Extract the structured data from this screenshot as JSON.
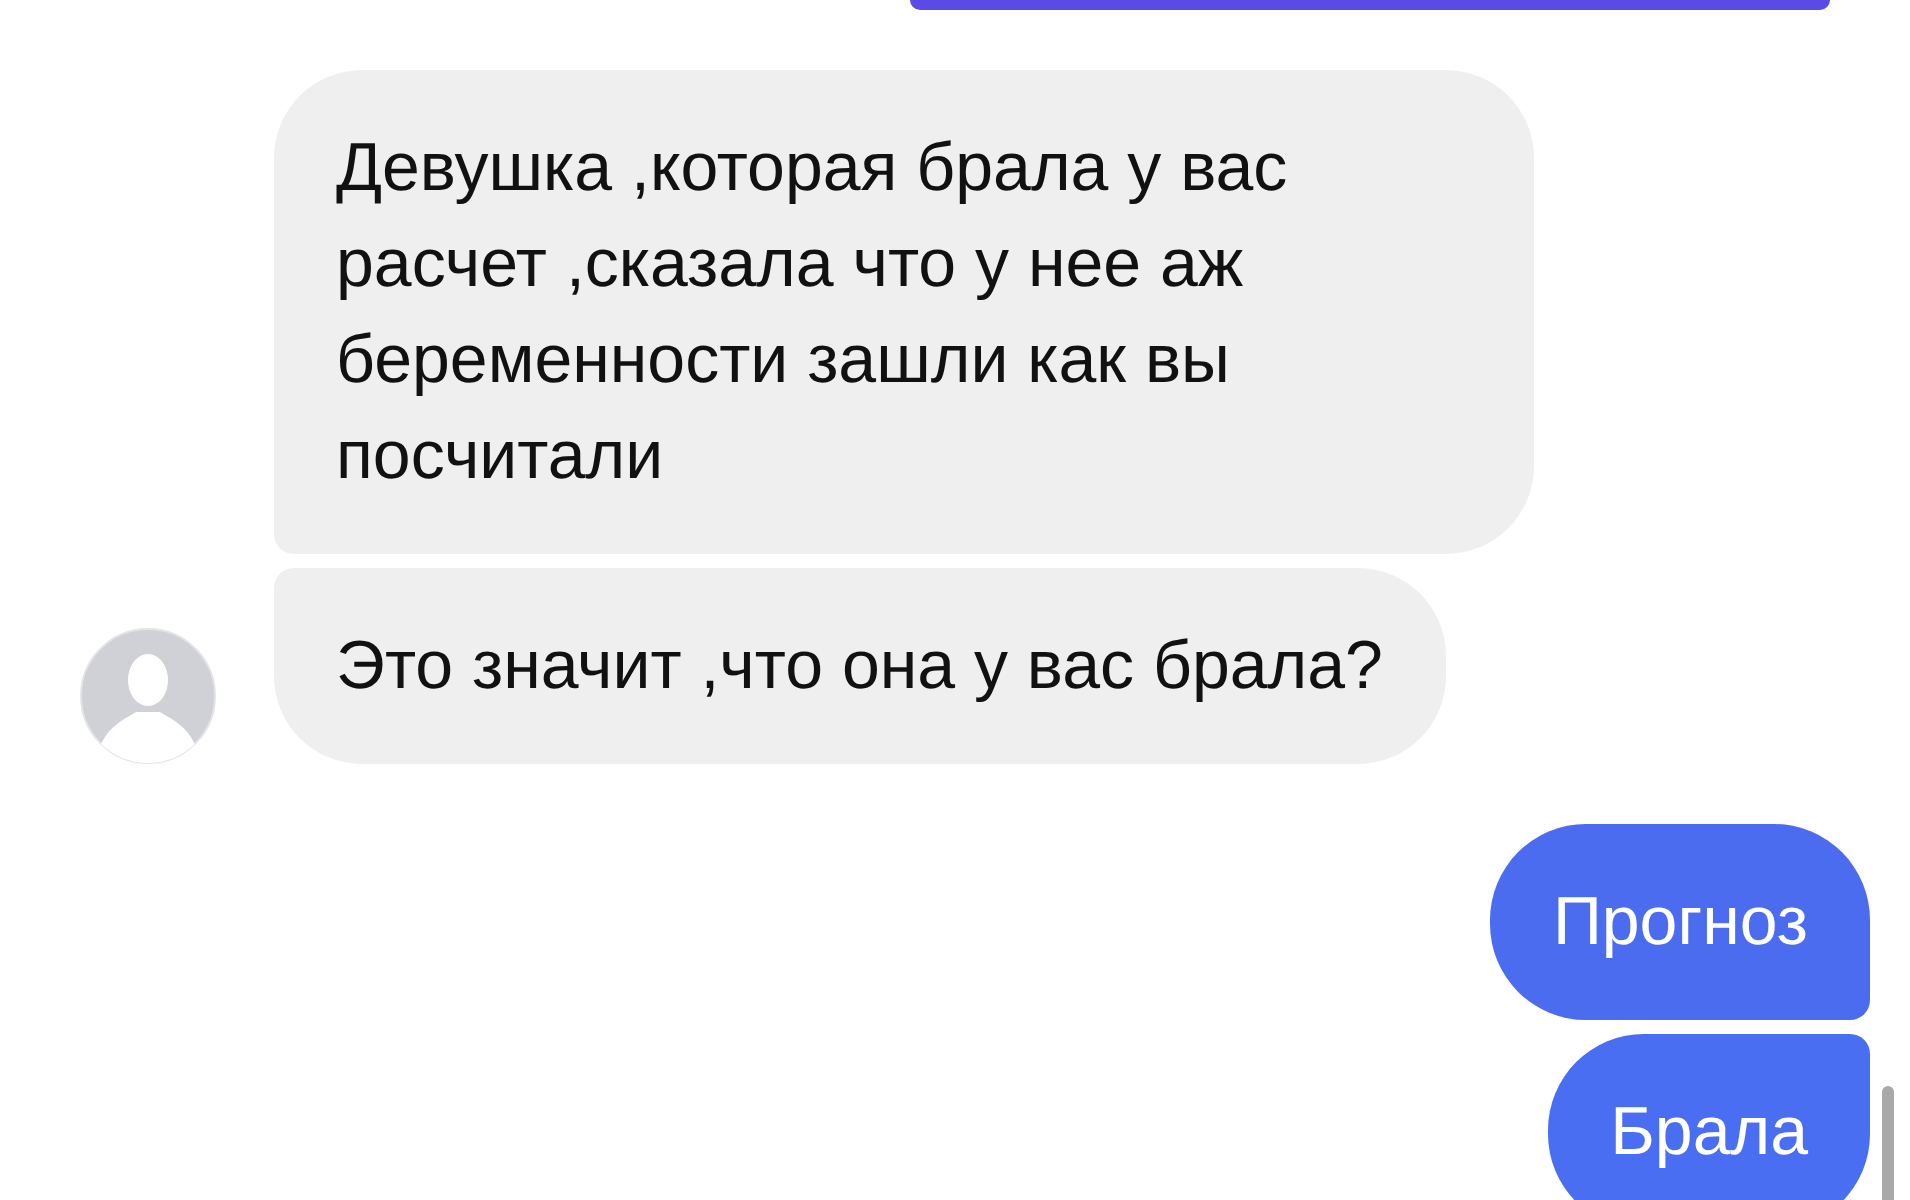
{
  "messages": [
    {
      "kind": "outgoing_cut",
      "color": "#5a4ae6"
    },
    {
      "kind": "incoming",
      "text": "Девушка ,которая брала у вас расчет ,сказала что у нее аж беременности зашли как вы посчитали",
      "avatar": false
    },
    {
      "kind": "incoming",
      "text": "Это значит ,что она у вас брала?",
      "avatar": true
    },
    {
      "kind": "outgoing",
      "text": "Прогноз",
      "color": "#4c6cef"
    },
    {
      "kind": "outgoing",
      "text": "Брала",
      "color": "#4a6ef2"
    }
  ]
}
